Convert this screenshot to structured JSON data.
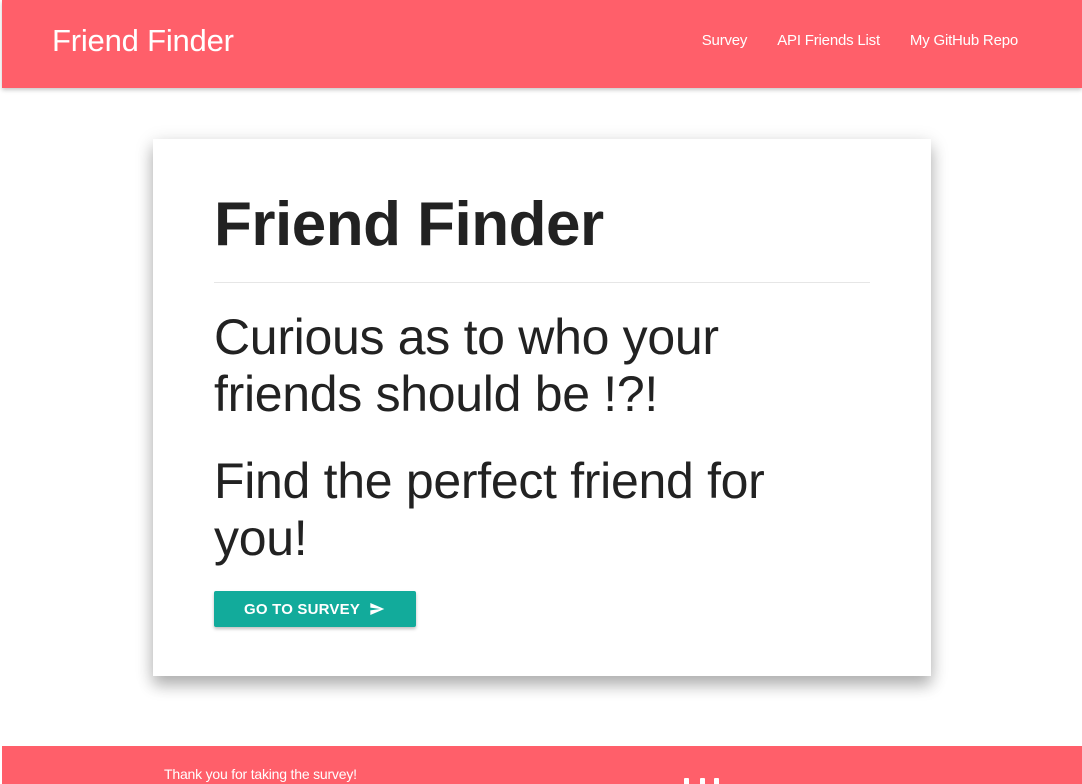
{
  "navbar": {
    "brand": "Friend Finder",
    "links": [
      {
        "label": "Survey"
      },
      {
        "label": "API Friends List"
      },
      {
        "label": "My GitHub Repo"
      }
    ],
    "background_color": "#ff5f6a"
  },
  "hero": {
    "title": "Friend Finder",
    "line_1": "Curious as to who your friends should be !?!",
    "line_2": "Find the perfect friend for you!",
    "button_label": "GO TO SURVEY",
    "button_icon": "send-icon",
    "button_color": "#12ab9b"
  },
  "footer": {
    "thanks_text": "Thank you for taking the survey!",
    "background_color": "#ff5f6a"
  }
}
